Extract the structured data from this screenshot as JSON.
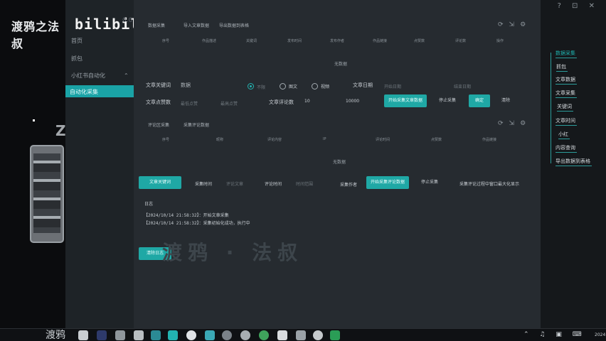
{
  "left_panel": {
    "channel_title": "渡鸦之法叔",
    "bilibili_logo": "bilibili",
    "version": "0.0",
    "glyph": "Z"
  },
  "sidebar": {
    "items": [
      {
        "label": "首页"
      },
      {
        "label": "抓包"
      },
      {
        "label": "小红书自动化"
      }
    ],
    "active_item": "自动化采集",
    "chevron": "⌃"
  },
  "top_tabs": [
    "数据采集",
    "导入文章数据",
    "导出数据到表格"
  ],
  "table1_columns": [
    "序号",
    "作品描述",
    "关键词",
    "发布时间",
    "发布作者",
    "作品链接",
    "点赞数",
    "评论数",
    "操作"
  ],
  "section1_label": "无数据",
  "filters": {
    "keyword_label": "文章关键词",
    "keyword_value": "数据",
    "radio_options": [
      "不限",
      "图文",
      "视频"
    ],
    "date_label": "文章日期",
    "date_placeholder": "开始日期",
    "date_end": "结束日期",
    "like_label": "文章点赞数",
    "like_min": "最低点赞",
    "like_max": "最高点赞",
    "comment_label": "文章评论数",
    "comment_min": "10",
    "comment_max": "10000"
  },
  "action_buttons": {
    "start": "开始采集文章数据",
    "stop": "停止采集",
    "confirm": "确定",
    "clear": "清除"
  },
  "sub_tabs": [
    "评论区采集",
    "采集评论数据"
  ],
  "table2_columns": [
    "序号",
    "昵称",
    "评论内容",
    "IP",
    "评论时间",
    "点赞数",
    "作品链接"
  ],
  "section2_label": "无数据",
  "comment_bar": {
    "tab_active": "文章关键词",
    "collect_time": "采集时间",
    "comment_article": "评论文章",
    "comment_time": "评论时间",
    "time_value": "时间范围",
    "author": "采集作者",
    "start": "开始采集评论数据",
    "stop": "停止采集",
    "hint": "采集评论过程中窗口最大化显示"
  },
  "log": {
    "title": "日志",
    "lines": [
      "【2024/10/14 21:58:32】：开始文章采集",
      "【2024/10/14 21:58:32】：采集初始化成功，执行中"
    ],
    "clear_button": "清除日志"
  },
  "watermark": "渡鸦 · 法叔",
  "mindmap": [
    "数据采集",
    "抓包",
    "文章数据",
    "文章采集",
    "关键词",
    "文章时间",
    "小红",
    "内容查询",
    "导出数据到表格"
  ],
  "taskbar": {
    "label": "渡鸦",
    "clock": "2024"
  },
  "colors": {
    "accent": "#1fa8a5",
    "panel": "#262b30",
    "sidebar": "#1e2327"
  }
}
